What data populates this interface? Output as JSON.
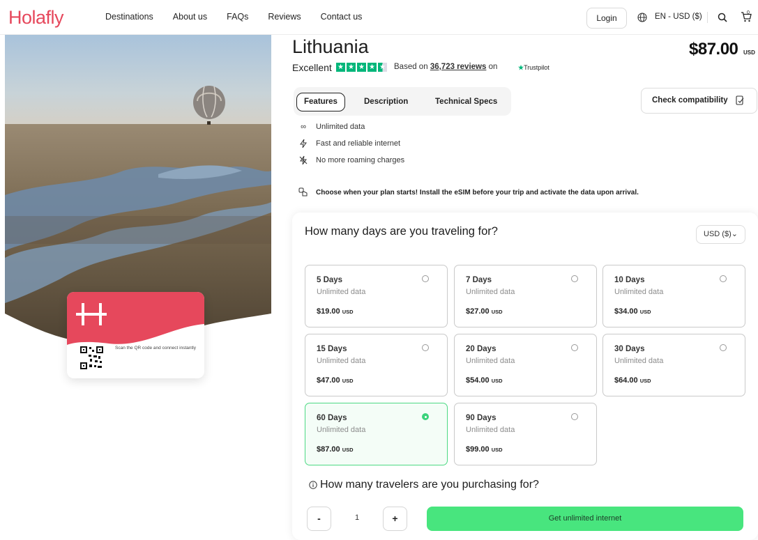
{
  "nav": {
    "logo": "Holafly",
    "links": [
      "Destinations",
      "About us",
      "FAQs",
      "Reviews",
      "Contact us"
    ],
    "login": "Login",
    "language": "EN - USD ($)",
    "cart_count": "0"
  },
  "product": {
    "title": "Lithuania",
    "price": "$87.00",
    "price_currency": "USD",
    "rating_word": "Excellent",
    "stars": 4.5,
    "based_on": "Based on",
    "review_count": "36,723 reviews",
    "on": "on",
    "trustpilot": "Trustpilot"
  },
  "sim_card": {
    "caption": "Scan the QR code and connect instantly"
  },
  "tabs": [
    "Features",
    "Description",
    "Technical Specs"
  ],
  "check_compatibility": "Check compatibility",
  "features": [
    "Unlimited data",
    "Fast and reliable internet",
    "No more roaming charges"
  ],
  "choose_note": "Choose when your plan starts! Install the eSIM before your trip and activate the data upon arrival.",
  "plans": {
    "question": "How many days are you traveling for?",
    "currency_select": "USD ($)",
    "options": [
      {
        "days": "5 Days",
        "data": "Unlimited data",
        "price": "$19.00",
        "cur": "USD"
      },
      {
        "days": "7 Days",
        "data": "Unlimited data",
        "price": "$27.00",
        "cur": "USD"
      },
      {
        "days": "10 Days",
        "data": "Unlimited data",
        "price": "$34.00",
        "cur": "USD"
      },
      {
        "days": "15 Days",
        "data": "Unlimited data",
        "price": "$47.00",
        "cur": "USD"
      },
      {
        "days": "20 Days",
        "data": "Unlimited data",
        "price": "$54.00",
        "cur": "USD"
      },
      {
        "days": "30 Days",
        "data": "Unlimited data",
        "price": "$64.00",
        "cur": "USD"
      },
      {
        "days": "60 Days",
        "data": "Unlimited data",
        "price": "$87.00",
        "cur": "USD"
      },
      {
        "days": "90 Days",
        "data": "Unlimited data",
        "price": "$99.00",
        "cur": "USD"
      }
    ],
    "selected": "60 Days"
  },
  "travelers": {
    "question": "How many travelers are you purchasing for?",
    "minus": "-",
    "plus": "+",
    "quantity": "1",
    "cta": "Get unlimited internet"
  },
  "colors": {
    "brand": "#e6485c",
    "accent_green": "#48e57e",
    "trustpilot_green": "#00b67a"
  }
}
